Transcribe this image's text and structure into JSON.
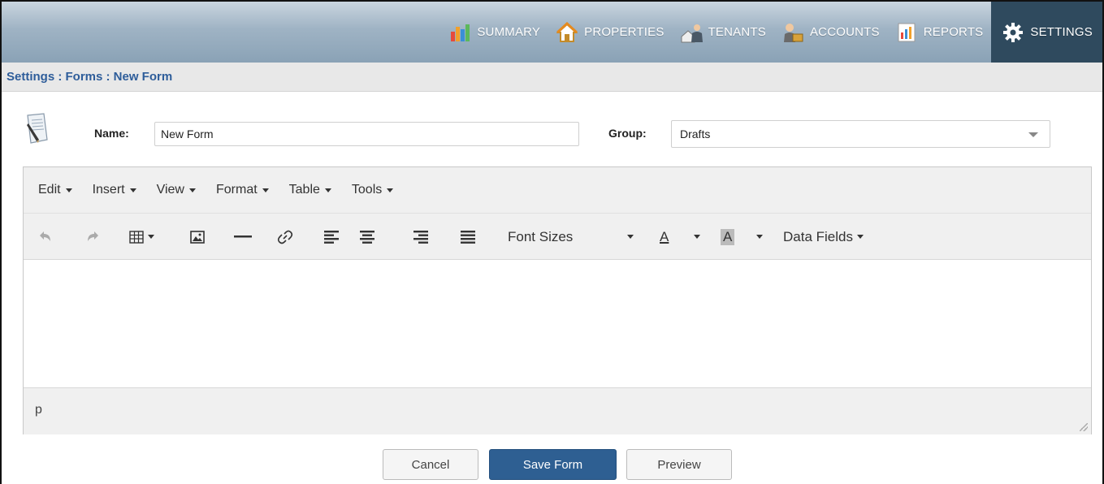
{
  "nav": {
    "items": [
      {
        "label": "SUMMARY",
        "icon": "bar-chart-icon"
      },
      {
        "label": "PROPERTIES",
        "icon": "house-icon"
      },
      {
        "label": "TENANTS",
        "icon": "tenants-icon"
      },
      {
        "label": "ACCOUNTS",
        "icon": "accounts-icon"
      },
      {
        "label": "REPORTS",
        "icon": "report-icon"
      },
      {
        "label": "SETTINGS",
        "icon": "gear-icon"
      }
    ],
    "active": "SETTINGS"
  },
  "breadcrumb": "Settings : Forms : New Form",
  "form": {
    "name_label": "Name:",
    "name_value": "New Form",
    "group_label": "Group:",
    "group_value": "Drafts"
  },
  "editor": {
    "menus": [
      "Edit",
      "Insert",
      "View",
      "Format",
      "Table",
      "Tools"
    ],
    "font_sizes_label": "Font Sizes",
    "text_color_glyph": "A",
    "bg_color_glyph": "A",
    "data_fields_label": "Data Fields",
    "status_path": "p"
  },
  "buttons": {
    "cancel": "Cancel",
    "save": "Save Form",
    "preview": "Preview"
  },
  "colors": {
    "accent": "#2e5f92",
    "breadcrumb": "#2e5d9a",
    "nav_active": "#2f4a5e"
  }
}
